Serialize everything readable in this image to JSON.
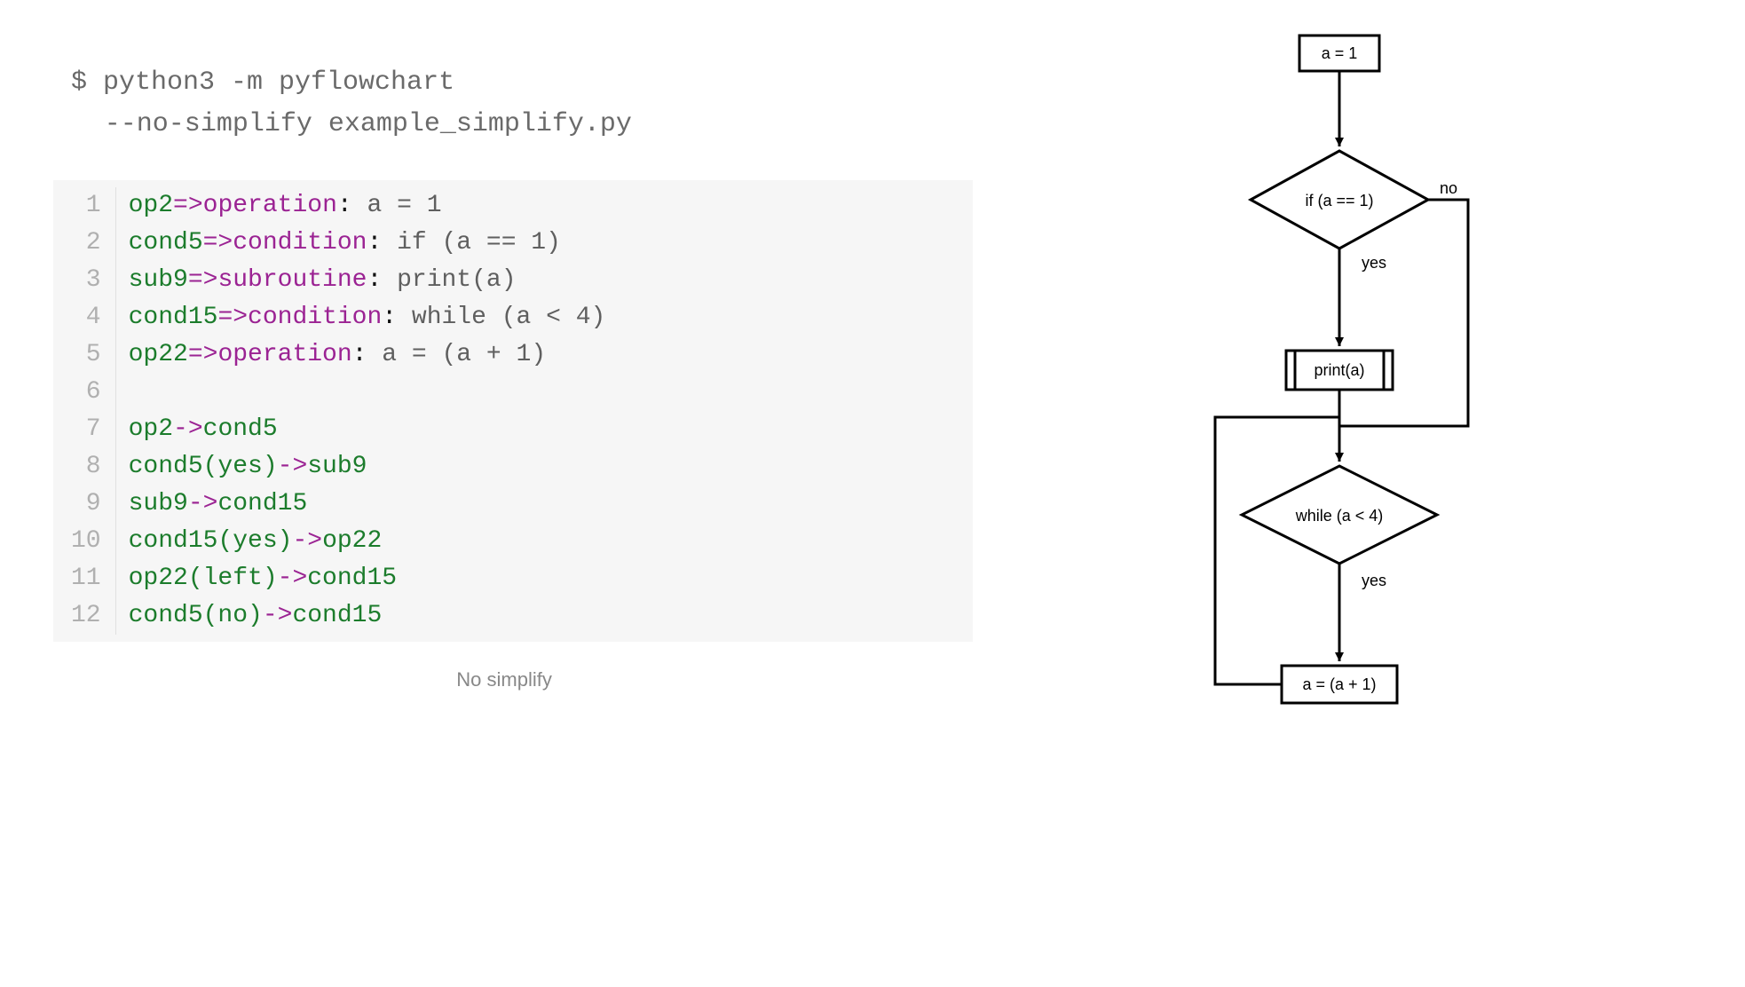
{
  "command": {
    "line1": "$ python3 -m pyflowchart",
    "line2": "--no-simplify example_simplify.py"
  },
  "code_lines": [
    {
      "name": "op2",
      "op": "=>",
      "type": "operation",
      "colon": ":",
      "text": " a = 1"
    },
    {
      "name": "cond5",
      "op": "=>",
      "type": "condition",
      "colon": ":",
      "text": " if (a == 1)"
    },
    {
      "name": "sub9",
      "op": "=>",
      "type": "subroutine",
      "colon": ":",
      "text": " print(a)"
    },
    {
      "name": "cond15",
      "op": "=>",
      "type": "condition",
      "colon": ":",
      "text": " while (a < 4)"
    },
    {
      "name": "op22",
      "op": "=>",
      "type": "operation",
      "colon": ":",
      "text": " a = (a + 1)"
    },
    {
      "blank": true
    },
    {
      "from": "op2",
      "arr": "->",
      "to": "cond5"
    },
    {
      "from": "cond5(yes)",
      "arr": "->",
      "to": "sub9"
    },
    {
      "from": "sub9",
      "arr": "->",
      "to": "cond15"
    },
    {
      "from": "cond15(yes)",
      "arr": "->",
      "to": "op22"
    },
    {
      "from": "op22(left)",
      "arr": "->",
      "to": "cond15"
    },
    {
      "from": "cond5(no)",
      "arr": "->",
      "to": "cond15"
    }
  ],
  "caption": "No simplify",
  "flowchart": {
    "nodes": {
      "op2": {
        "label": "a = 1"
      },
      "cond5": {
        "label": "if (a == 1)",
        "yes": "yes",
        "no": "no"
      },
      "sub9": {
        "label": "print(a)"
      },
      "cond15": {
        "label": "while (a < 4)",
        "yes": "yes"
      },
      "op22": {
        "label": "a = (a + 1)"
      }
    }
  },
  "chart_data": {
    "type": "flowchart",
    "nodes": [
      {
        "id": "op2",
        "kind": "operation",
        "label": "a = 1"
      },
      {
        "id": "cond5",
        "kind": "condition",
        "label": "if (a == 1)"
      },
      {
        "id": "sub9",
        "kind": "subroutine",
        "label": "print(a)"
      },
      {
        "id": "cond15",
        "kind": "condition",
        "label": "while (a < 4)"
      },
      {
        "id": "op22",
        "kind": "operation",
        "label": "a = (a + 1)"
      }
    ],
    "edges": [
      {
        "from": "op2",
        "to": "cond5"
      },
      {
        "from": "cond5",
        "to": "sub9",
        "label": "yes"
      },
      {
        "from": "cond5",
        "to": "cond15",
        "label": "no"
      },
      {
        "from": "sub9",
        "to": "cond15"
      },
      {
        "from": "cond15",
        "to": "op22",
        "label": "yes"
      },
      {
        "from": "op22",
        "to": "cond15",
        "direction": "left-loop"
      }
    ]
  }
}
